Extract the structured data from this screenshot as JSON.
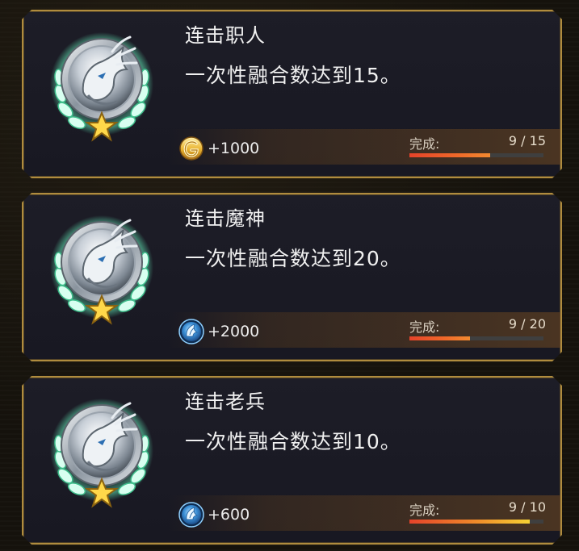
{
  "achievements": [
    {
      "title": "连击职人",
      "description": "一次性融合数达到15。",
      "reward": {
        "icon": "gold-coin-icon",
        "value": "+1000"
      },
      "progress": {
        "label": "完成:",
        "current": 9,
        "total": 15,
        "text": "9 / 15",
        "fraction": 0.6
      }
    },
    {
      "title": "连击魔神",
      "description": "一次性融合数达到20。",
      "reward": {
        "icon": "blue-feather-gem-icon",
        "value": "+2000"
      },
      "progress": {
        "label": "完成:",
        "current": 9,
        "total": 20,
        "text": "9 / 20",
        "fraction": 0.45
      }
    },
    {
      "title": "连击老兵",
      "description": "一次性融合数达到10。",
      "reward": {
        "icon": "blue-feather-gem-icon",
        "value": "+600"
      },
      "progress": {
        "label": "完成:",
        "current": 9,
        "total": 10,
        "text": "9 / 10",
        "fraction": 0.9
      }
    }
  ],
  "colors": {
    "frame_gold": "#b08c3e",
    "progress_start": "#e5432a",
    "progress_end": "#f7d234",
    "medal_green": "#5fe0b0"
  }
}
